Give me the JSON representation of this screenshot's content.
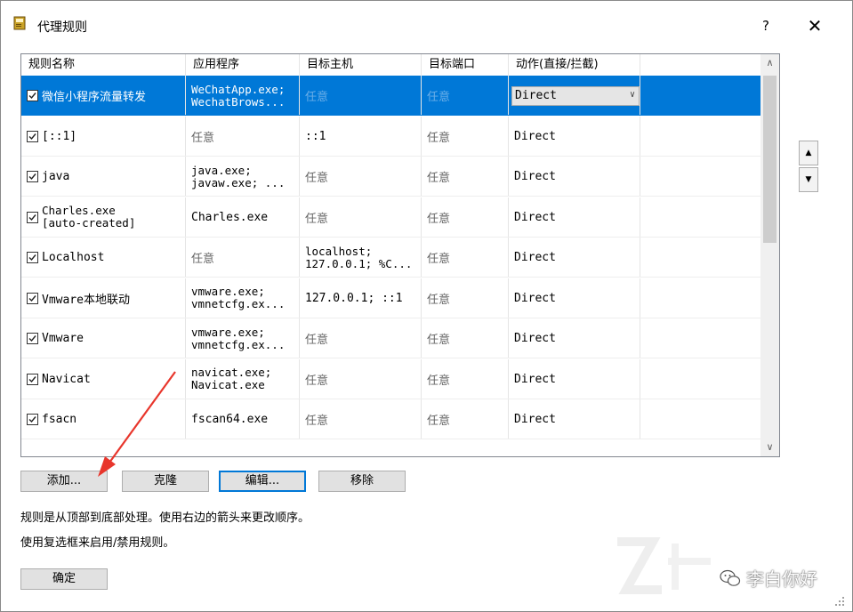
{
  "window": {
    "title": "代理规则",
    "help_label": "?",
    "close_label": "✕"
  },
  "table": {
    "headers": [
      "规则名称",
      "应用程序",
      "目标主机",
      "目标端口",
      "动作(直接/拦截)"
    ],
    "rows": [
      {
        "name": "微信小程序流量转发",
        "app": "WeChatApp.exe;\nWechatBrows...",
        "host": "任意",
        "port": "任意",
        "action": "Direct",
        "checked": true,
        "selected": true
      },
      {
        "name": "[::1]",
        "app": "任意",
        "host": "::1",
        "port": "任意",
        "action": "Direct",
        "checked": true
      },
      {
        "name": "java",
        "app": "java.exe;\njavaw.exe; ...",
        "host": "任意",
        "port": "任意",
        "action": "Direct",
        "checked": true
      },
      {
        "name": "Charles.exe\n[auto-created]",
        "app": "Charles.exe",
        "host": "任意",
        "port": "任意",
        "action": "Direct",
        "checked": true
      },
      {
        "name": "Localhost",
        "app": "任意",
        "host": "localhost;\n127.0.0.1; %C...",
        "port": "任意",
        "action": "Direct",
        "checked": true
      },
      {
        "name": "Vmware本地联动",
        "app": "vmware.exe;\nvmnetcfg.ex...",
        "host": "127.0.0.1; ::1",
        "port": "任意",
        "action": "Direct",
        "checked": true
      },
      {
        "name": "Vmware",
        "app": "vmware.exe;\nvmnetcfg.ex...",
        "host": "任意",
        "port": "任意",
        "action": "Direct",
        "checked": true
      },
      {
        "name": "Navicat",
        "app": "navicat.exe;\nNavicat.exe",
        "host": "任意",
        "port": "任意",
        "action": "Direct",
        "checked": true
      },
      {
        "name": "fsacn",
        "app": "fscan64.exe",
        "host": "任意",
        "port": "任意",
        "action": "Direct",
        "checked": true
      }
    ]
  },
  "scrollbar": {
    "up": "∧",
    "down": "∨"
  },
  "order": {
    "up": "▲",
    "down": "▼"
  },
  "buttons": {
    "add": "添加...",
    "clone": "克隆",
    "edit": "编辑...",
    "remove": "移除",
    "ok": "确定"
  },
  "info": {
    "line1": "规则是从顶部到底部处理。使用右边的箭头来更改顺序。",
    "line2": "使用复选框来启用/禁用规则。"
  },
  "watermark": {
    "text": "李白你好"
  },
  "colors": {
    "selection": "#0078d7",
    "arrow": "#e8362c",
    "default_button_border": "#0078d7"
  },
  "icons": {
    "app": "rules-book-icon",
    "wechat": "wechat-icon"
  }
}
